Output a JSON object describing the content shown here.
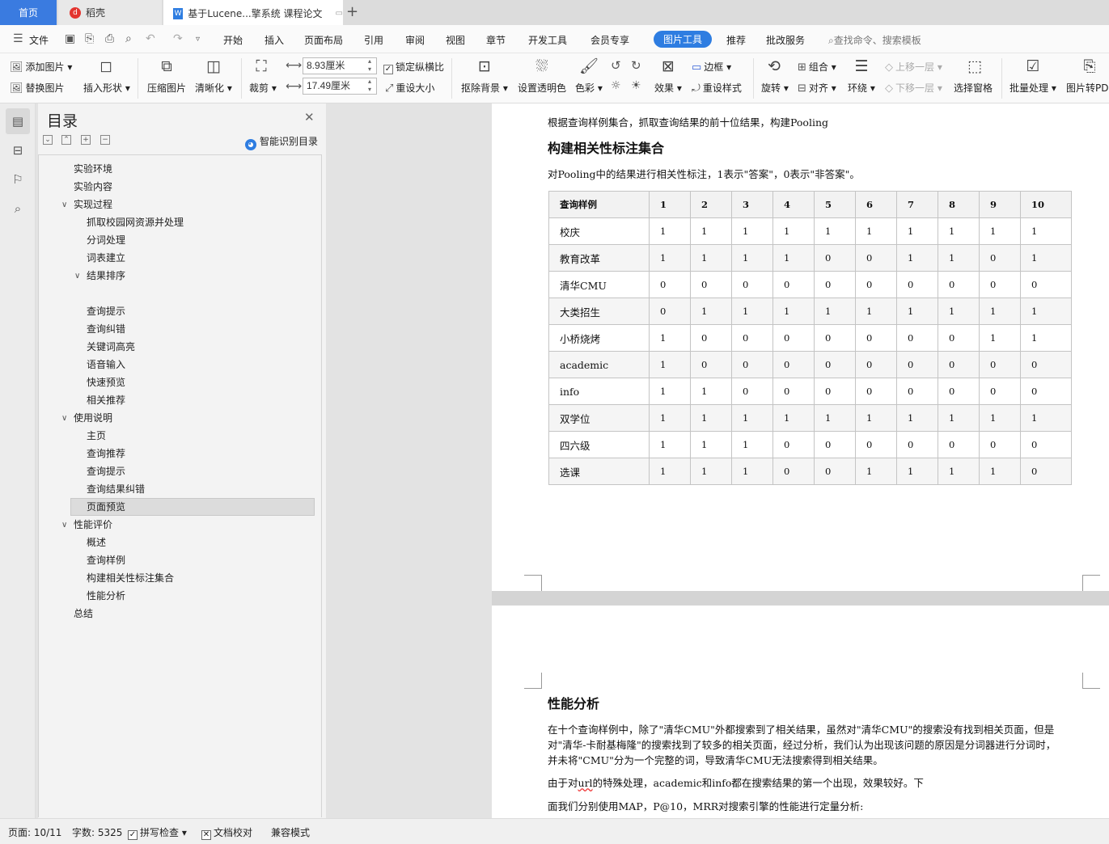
{
  "tabs": {
    "home": "首页",
    "daoke": "稻壳",
    "doc": "基于Lucene...擎系统 课程论文"
  },
  "menubar": {
    "file": "文件",
    "items": [
      "开始",
      "插入",
      "页面布局",
      "引用",
      "审阅",
      "视图",
      "章节",
      "开发工具",
      "会员专享",
      "图片工具",
      "推荐",
      "批改服务"
    ],
    "active": "图片工具",
    "search": "查找命令、搜索模板"
  },
  "ribbon": {
    "add_image": "添加图片",
    "replace_image": "替换图片",
    "insert_shape": "插入形状",
    "compress": "压缩图片",
    "sharpen": "清晰化",
    "crop": "裁剪",
    "width": "8.93厘米",
    "height": "17.49厘米",
    "lock_ratio": "锁定纵横比",
    "reset_size": "重设大小",
    "remove_bg": "抠除背景",
    "transparent": "设置透明色",
    "color": "色彩",
    "effect": "效果",
    "border": "边框",
    "reset_style": "重设样式",
    "rotate": "旋转",
    "group": "组合",
    "align": "对齐",
    "wrap": "环绕",
    "bring_forward": "上移一层",
    "send_backward": "下移一层",
    "select_pane": "选择窗格",
    "batch": "批量处理",
    "to_pdf": "图片转PD"
  },
  "nav": {
    "title": "目录",
    "smart": "智能识别目录",
    "items": [
      {
        "label": "实验环境"
      },
      {
        "label": "实验内容"
      },
      {
        "label": "实现过程"
      },
      {
        "label": "抓取校园网资源并处理"
      },
      {
        "label": "分词处理"
      },
      {
        "label": "词表建立"
      },
      {
        "label": "结果排序"
      },
      {
        "label": "查询提示"
      },
      {
        "label": "查询纠错"
      },
      {
        "label": "关键词高亮"
      },
      {
        "label": "语音输入"
      },
      {
        "label": "快速预览"
      },
      {
        "label": "相关推荐"
      },
      {
        "label": "使用说明"
      },
      {
        "label": "主页"
      },
      {
        "label": "查询推荐"
      },
      {
        "label": "查询提示"
      },
      {
        "label": "查询结果纠错"
      },
      {
        "label": "页面预览"
      },
      {
        "label": "性能评价"
      },
      {
        "label": "概述"
      },
      {
        "label": "查询样例"
      },
      {
        "label": "构建相关性标注集合"
      },
      {
        "label": "性能分析"
      },
      {
        "label": "总结"
      }
    ],
    "selected": "页面预览"
  },
  "doc": {
    "p_pool": "根据查询样例集合，抓取查询结果的前十位结果，构建Pooling",
    "h_build": "构建相关性标注集合",
    "p_label": "对Pooling中的结果进行相关性标注，1表示\"答案\"，0表示\"非答案\"。",
    "table": {
      "headers": [
        "查询样例",
        "1",
        "2",
        "3",
        "4",
        "5",
        "6",
        "7",
        "8",
        "9",
        "10"
      ],
      "rows": [
        {
          "name": "校庆",
          "vals": [
            "1",
            "1",
            "1",
            "1",
            "1",
            "1",
            "1",
            "1",
            "1",
            "1"
          ]
        },
        {
          "name": "教育改革",
          "vals": [
            "1",
            "1",
            "1",
            "1",
            "0",
            "0",
            "1",
            "1",
            "0",
            "1"
          ]
        },
        {
          "name": "清华CMU",
          "vals": [
            "0",
            "0",
            "0",
            "0",
            "0",
            "0",
            "0",
            "0",
            "0",
            "0"
          ]
        },
        {
          "name": "大类招生",
          "vals": [
            "0",
            "1",
            "1",
            "1",
            "1",
            "1",
            "1",
            "1",
            "1",
            "1"
          ]
        },
        {
          "name": "小桥烧烤",
          "vals": [
            "1",
            "0",
            "0",
            "0",
            "0",
            "0",
            "0",
            "0",
            "1",
            "1"
          ]
        },
        {
          "name": "academic",
          "vals": [
            "1",
            "0",
            "0",
            "0",
            "0",
            "0",
            "0",
            "0",
            "0",
            "0"
          ]
        },
        {
          "name": "info",
          "vals": [
            "1",
            "1",
            "0",
            "0",
            "0",
            "0",
            "0",
            "0",
            "0",
            "0"
          ]
        },
        {
          "name": "双学位",
          "vals": [
            "1",
            "1",
            "1",
            "1",
            "1",
            "1",
            "1",
            "1",
            "1",
            "1"
          ]
        },
        {
          "name": "四六级",
          "vals": [
            "1",
            "1",
            "1",
            "0",
            "0",
            "0",
            "0",
            "0",
            "0",
            "0"
          ]
        },
        {
          "name": "选课",
          "vals": [
            "1",
            "1",
            "1",
            "0",
            "0",
            "1",
            "1",
            "1",
            "1",
            "0"
          ]
        }
      ]
    },
    "h_perf": "性能分析",
    "p_perf1": "在十个查询样例中，除了\"清华CMU\"外都搜索到了相关结果，虽然对\"清华CMU\"的搜索没有找到相关页面，但是",
    "p_perf2": "对\"清华-卡耐基梅隆\"的搜索找到了较多的相关页面，经过分析，我们认为出现该问题的原因是分词器进行分词时，",
    "p_perf3": "并未将\"CMU\"分为一个完整的词，导致清华CMU无法搜索得到相关结果。",
    "p_url_a": "由于对",
    "p_url_u": "url",
    "p_url_b": "的特殊处理，academic和info都在搜索结果的第一个出现，效果较好。下",
    "p_map": "面我们分别使用MAP，P@10，MRR对搜索引擎的性能进行定量分析:"
  },
  "status": {
    "page": "页面: 10/11",
    "words": "字数: 5325",
    "spell": "拼写检查",
    "proof": "文档校对",
    "compat": "兼容模式"
  }
}
